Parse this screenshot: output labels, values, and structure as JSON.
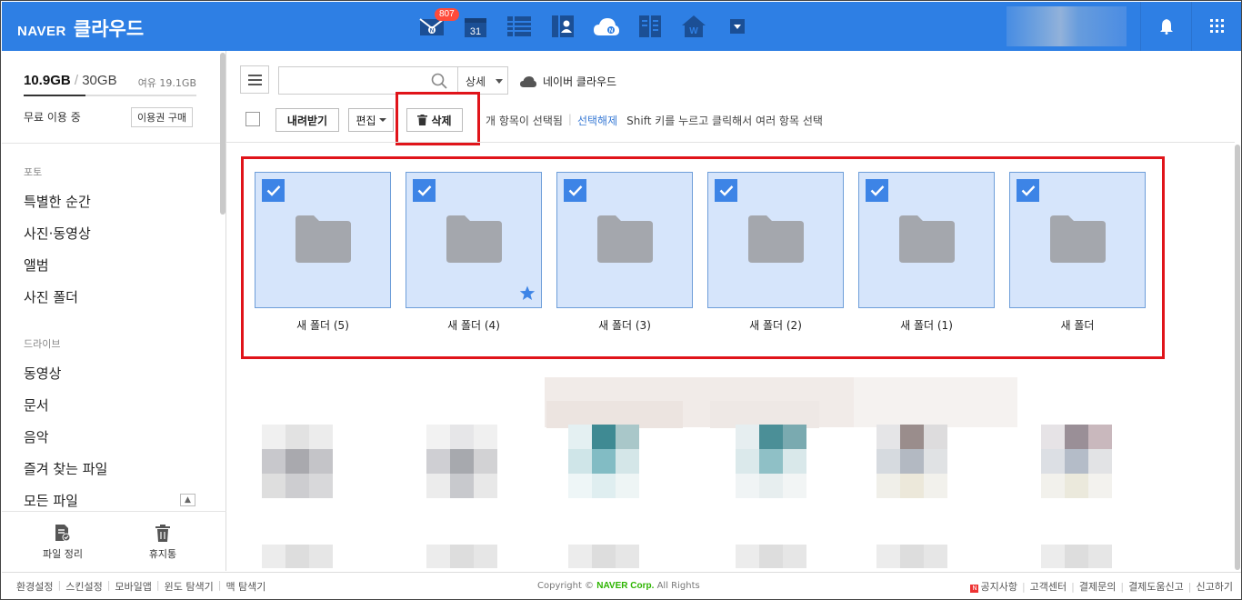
{
  "header": {
    "brand_naver": "NAVER",
    "brand_service": "클라우드",
    "mail_badge": "807",
    "calendar_day": "31",
    "colors": {
      "bar": "#2e7fe4",
      "badge": "#ff4b3a",
      "highlight": "#e0141a",
      "selected_tile": "#d6e5fb",
      "checkbox": "#3d84e6"
    },
    "icons": [
      "mail-icon",
      "calendar-icon",
      "memo-icon",
      "contacts-icon",
      "cloud-icon",
      "note-icon",
      "home-icon",
      "more-apps-icon",
      "notification-bell-icon",
      "app-grid-icon"
    ]
  },
  "sidebar": {
    "used": "10.9GB",
    "total": "30GB",
    "free": "여유 19.1GB",
    "usage_fraction": 0.36,
    "plan": "무료 이용 중",
    "buy": "이용권 구매",
    "sections": [
      {
        "title": "포토",
        "items": [
          "특별한 순간",
          "사진·동영상",
          "앨범",
          "사진 폴더"
        ]
      },
      {
        "title": "드라이브",
        "items": [
          "동영상",
          "문서",
          "음악",
          "즐겨 찾는 파일",
          "모든 파일"
        ]
      }
    ],
    "tools": [
      {
        "label": "파일 정리",
        "icon": "file-cleanup-icon"
      },
      {
        "label": "휴지통",
        "icon": "trash-icon"
      }
    ]
  },
  "toolbar": {
    "search_placeholder": "",
    "detail": "상세",
    "location": "네이버 클라우드",
    "download": "내려받기",
    "edit": "편집",
    "delete": "삭제",
    "selected_text": "개 항목이 선택됨",
    "clear_selection": "선택해제",
    "shift_hint": "Shift 키를 누르고 클릭해서 여러 항목 선택"
  },
  "folders": [
    {
      "name": "새 폴더 (5)",
      "checked": true,
      "starred": false
    },
    {
      "name": "새 폴더 (4)",
      "checked": true,
      "starred": true
    },
    {
      "name": "새 폴더 (3)",
      "checked": true,
      "starred": false
    },
    {
      "name": "새 폴더 (2)",
      "checked": true,
      "starred": false
    },
    {
      "name": "새 폴더 (1)",
      "checked": true,
      "starred": false
    },
    {
      "name": "새 폴더",
      "checked": true,
      "starred": false
    }
  ],
  "footer": {
    "left": [
      "환경설정",
      "스킨설정",
      "모바일앱",
      "윈도 탐색기",
      "맥 탐색기"
    ],
    "copyright_prefix": "Copyright ©",
    "copyright_corp": "NAVER Corp.",
    "copyright_suffix": "All Rights",
    "right": [
      "공지사항",
      "고객센터",
      "결제문의",
      "결제도움신고",
      "신고하기"
    ]
  }
}
